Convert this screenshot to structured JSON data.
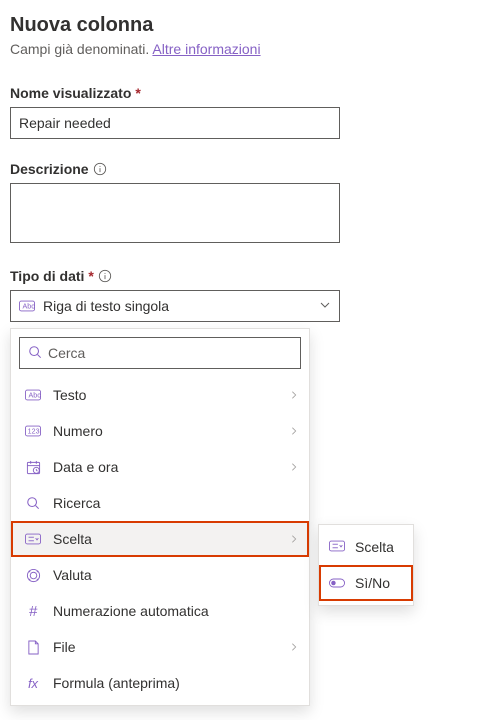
{
  "header": {
    "title": "Nuova colonna",
    "subtitle_prefix": "Campi già denominati. ",
    "subtitle_link": "Altre informazioni"
  },
  "fields": {
    "display_name": {
      "label": "Nome visualizzato",
      "value": "Repair needed"
    },
    "description": {
      "label": "Descrizione",
      "value": ""
    },
    "data_type": {
      "label": "Tipo di dati",
      "selected": "Riga di testo singola"
    }
  },
  "dropdown": {
    "search_placeholder": "Cerca",
    "items": [
      {
        "label": "Testo",
        "has_submenu": true
      },
      {
        "label": "Numero",
        "has_submenu": true
      },
      {
        "label": "Data e ora",
        "has_submenu": true
      },
      {
        "label": "Ricerca",
        "has_submenu": false
      },
      {
        "label": "Scelta",
        "has_submenu": true,
        "selected": true
      },
      {
        "label": "Valuta",
        "has_submenu": false
      },
      {
        "label": "Numerazione automatica",
        "has_submenu": false
      },
      {
        "label": "File",
        "has_submenu": true
      },
      {
        "label": "Formula (anteprima)",
        "has_submenu": false
      }
    ]
  },
  "submenu": {
    "items": [
      {
        "label": "Scelta"
      },
      {
        "label": "Sì/No",
        "highlighted": true
      }
    ]
  }
}
